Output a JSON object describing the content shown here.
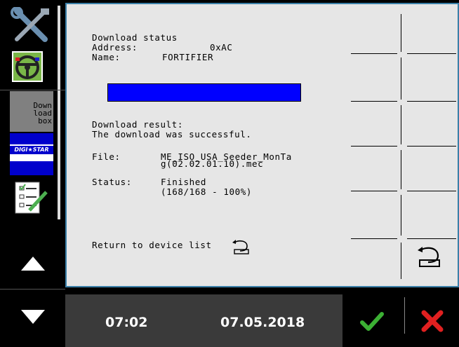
{
  "sidebar": {
    "download_box_label": "Down\nload\nbox",
    "digistar_label": "DIGI★STAR"
  },
  "download": {
    "title": "Download status",
    "address_label": "Address:",
    "address_value": "0xAC",
    "name_label": "Name:",
    "name_value": "FORTIFIER",
    "progress_fraction": 1.0,
    "result_label": "Download result:",
    "result_message": "The download was successful.",
    "file_label": "File:",
    "file_value_line1": "ME_ISO_USA_Seeder_MonTa",
    "file_value_line2": "g(02.02.01.10).mec",
    "status_label": "Status:",
    "status_value_line1": "Finished",
    "status_value_line2": "(168/168 - 100%)",
    "return_label": "Return to device list"
  },
  "bottom_bar": {
    "time": "07:02",
    "date": "07.05.2018"
  },
  "colors": {
    "progress": "#0000ff",
    "panel_border": "#3a7fa8",
    "ok": "#3cb034",
    "cancel": "#e02020"
  }
}
